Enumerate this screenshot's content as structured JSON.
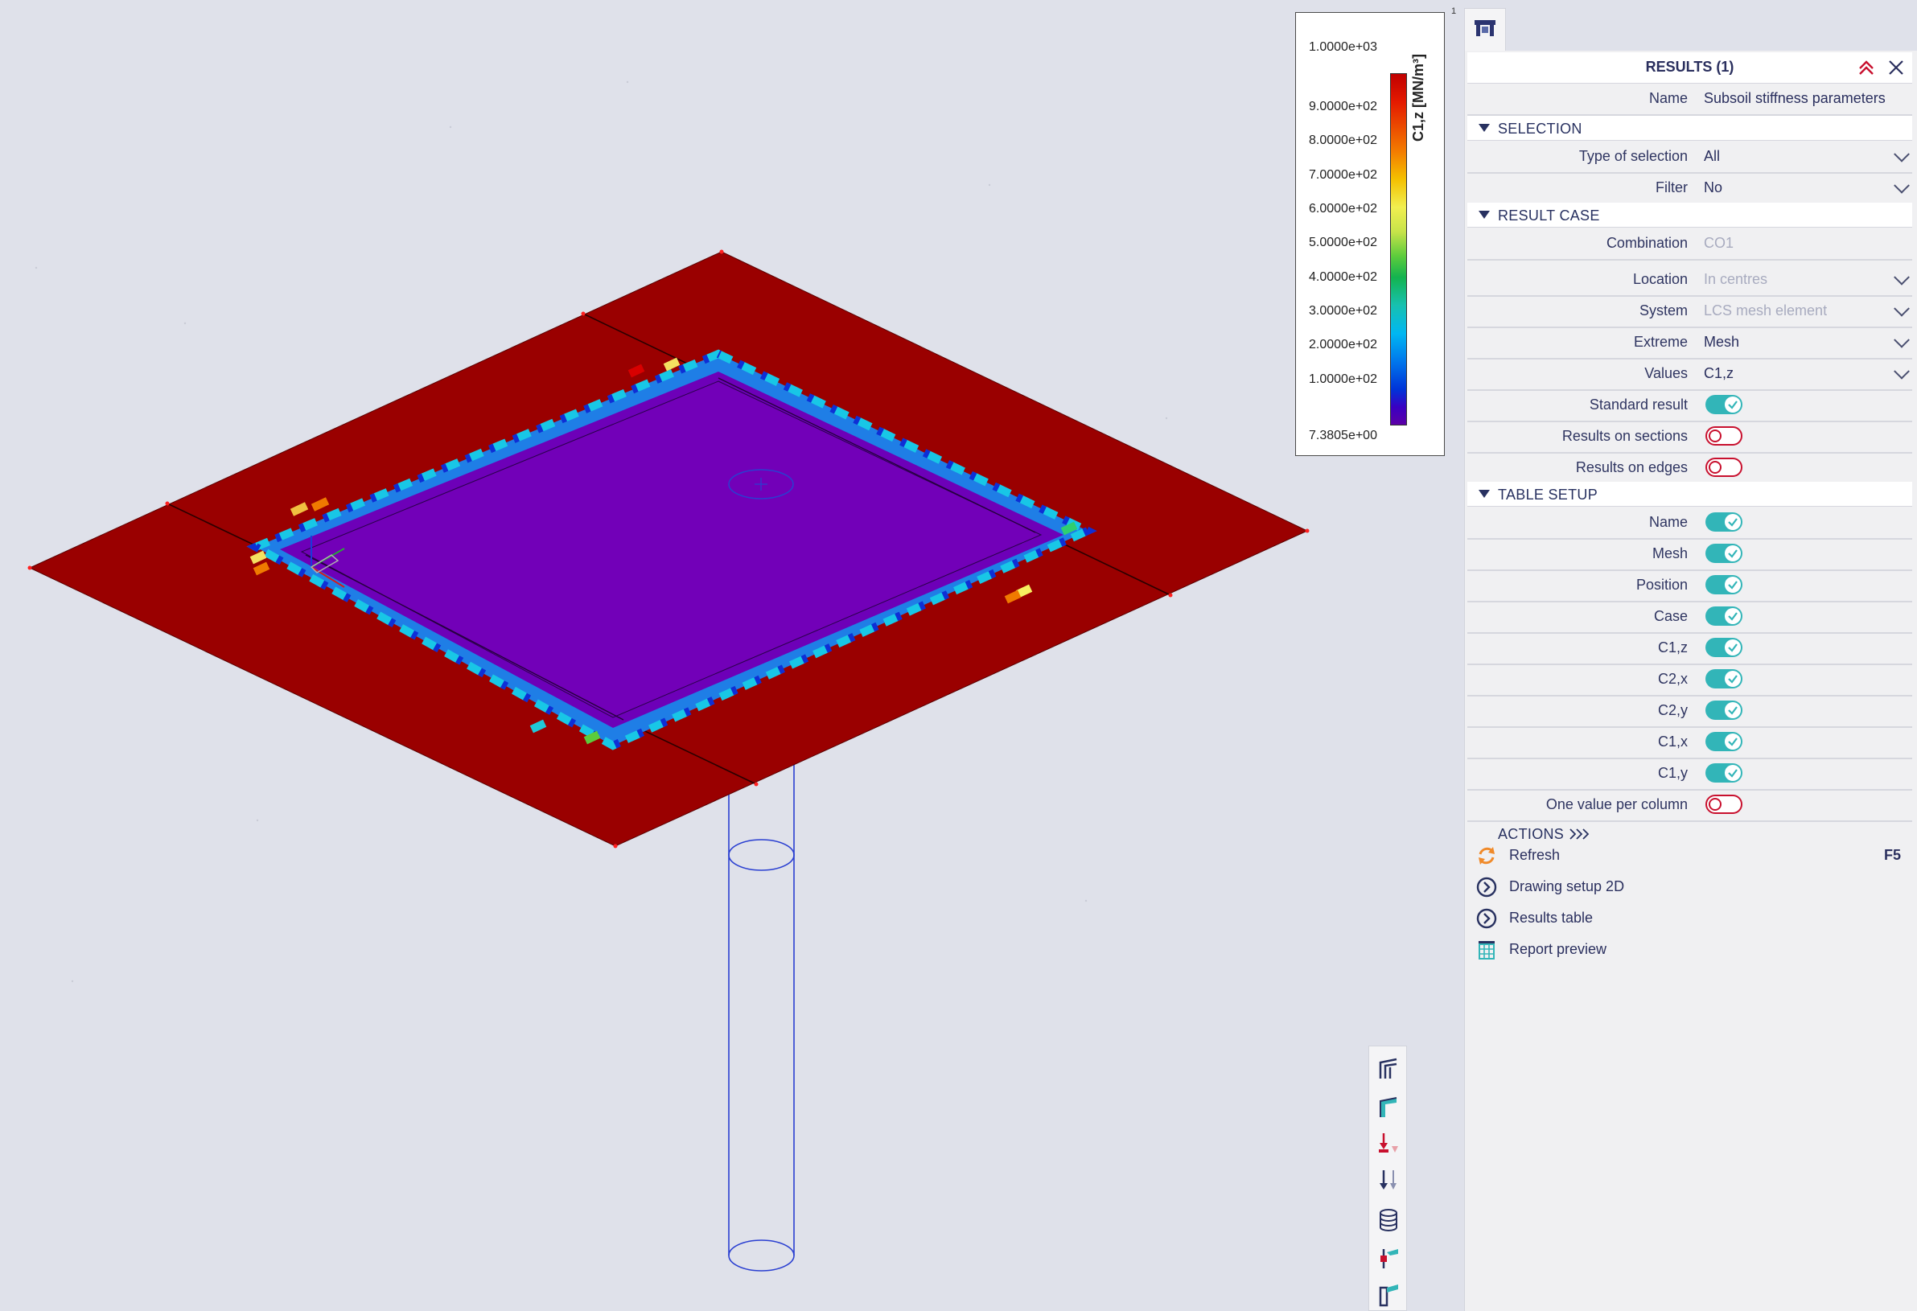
{
  "legend": {
    "unit": "C1,z [MN/m³]",
    "labels": [
      "1.0000e+03",
      "9.0000e+02",
      "8.0000e+02",
      "7.0000e+02",
      "6.0000e+02",
      "5.0000e+02",
      "4.0000e+02",
      "3.0000e+02",
      "2.0000e+02",
      "1.0000e+02",
      "7.3805e+00"
    ],
    "tick_marker": "1"
  },
  "panel": {
    "title": "RESULTS (1)",
    "name_label": "Name",
    "name_value": "Subsoil stiffness parameters",
    "sections": {
      "selection": "SELECTION",
      "result_case": "RESULT CASE",
      "table_setup": "TABLE SETUP",
      "actions": "ACTIONS"
    },
    "selection": [
      {
        "label": "Type of selection",
        "value": "All"
      },
      {
        "label": "Filter",
        "value": "No"
      }
    ],
    "combination": {
      "label": "Combination",
      "value": "CO1"
    },
    "result_fields": [
      {
        "label": "Location",
        "value": "In centres"
      },
      {
        "label": "System",
        "value": "LCS mesh element"
      },
      {
        "label": "Extreme",
        "value": "Mesh"
      },
      {
        "label": "Values",
        "value": "C1,z"
      }
    ],
    "result_toggles": [
      {
        "label": "Standard result",
        "on": true
      },
      {
        "label": "Results on sections",
        "on": false
      },
      {
        "label": "Results on edges",
        "on": false
      }
    ],
    "table_setup": [
      {
        "label": "Name",
        "on": true
      },
      {
        "label": "Mesh",
        "on": true
      },
      {
        "label": "Position",
        "on": true
      },
      {
        "label": "Case",
        "on": true
      },
      {
        "label": "C1,z",
        "on": true
      },
      {
        "label": "C2,x",
        "on": true
      },
      {
        "label": "C2,y",
        "on": true
      },
      {
        "label": "C1,x",
        "on": true
      },
      {
        "label": "C1,y",
        "on": true
      },
      {
        "label": "One value per column",
        "on": false
      }
    ],
    "actions": [
      {
        "label": "Refresh",
        "shortcut": "F5",
        "icon": "refresh-icon"
      },
      {
        "label": "Drawing setup 2D",
        "shortcut": "",
        "icon": "chevron-circle-icon"
      },
      {
        "label": "Results table",
        "shortcut": "",
        "icon": "chevron-circle-icon"
      },
      {
        "label": "Report preview",
        "shortcut": "",
        "icon": "report-icon"
      }
    ]
  },
  "colors": {
    "slab": "#9a0000",
    "inner": "#6d00b8",
    "accent": "#32b5b8",
    "off": "#c8102e"
  },
  "side_toolbar": [
    "frame-view-icon",
    "frame-shaded-icon",
    "loads-icon",
    "supports-icon",
    "database-icon",
    "member-icon",
    "section-icon"
  ]
}
